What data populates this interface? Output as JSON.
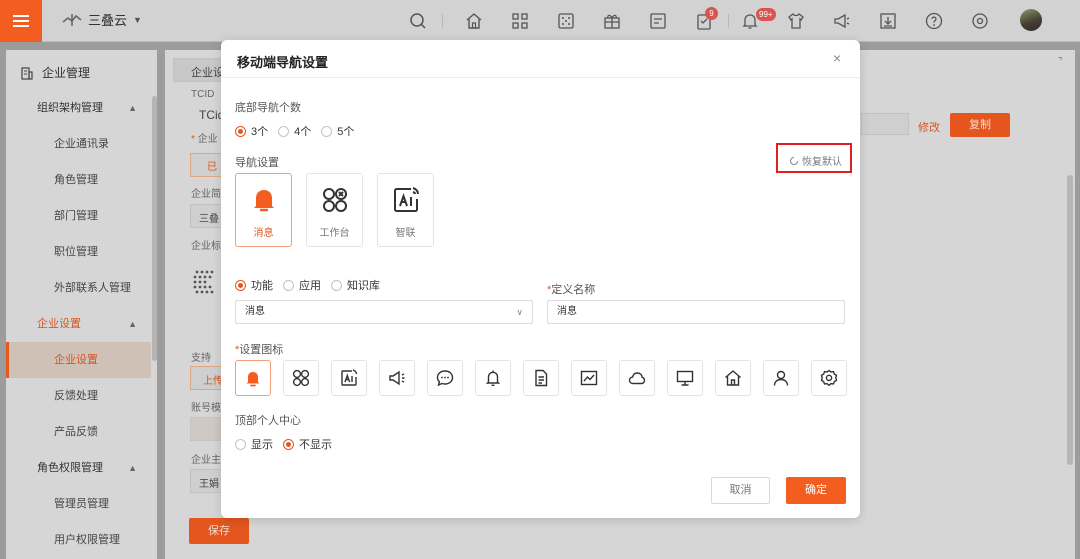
{
  "topbar": {
    "brand_name": "三叠云",
    "icons": [
      "search-icon",
      "home-icon",
      "apps-icon",
      "dice-icon",
      "gift-icon",
      "form-icon",
      "task-icon",
      "bell-icon",
      "shirt-icon",
      "megaphone-icon",
      "download-icon",
      "help-icon",
      "settings-icon"
    ],
    "task_badge": "9",
    "bell_badge": "99+",
    "accent_color": "#f35d1f"
  },
  "sidebar": {
    "title": "企业管理",
    "items": [
      {
        "label": "组织架构管理",
        "kind": "group"
      },
      {
        "label": "企业通讯录",
        "kind": "sub"
      },
      {
        "label": "角色管理",
        "kind": "sub"
      },
      {
        "label": "部门管理",
        "kind": "sub"
      },
      {
        "label": "职位管理",
        "kind": "sub"
      },
      {
        "label": "外部联系人管理",
        "kind": "sub"
      },
      {
        "label": "企业设置",
        "kind": "group-active"
      },
      {
        "label": "企业设置",
        "kind": "active"
      },
      {
        "label": "反馈处理",
        "kind": "sub"
      },
      {
        "label": "产品反馈",
        "kind": "sub"
      },
      {
        "label": "角色权限管理",
        "kind": "group"
      },
      {
        "label": "管理员管理",
        "kind": "sub"
      },
      {
        "label": "用户权限管理",
        "kind": "sub"
      }
    ]
  },
  "background": {
    "tcid_label": "TCID",
    "tcid_value": "TCid",
    "modify_label": "修改",
    "copy_label": "复制",
    "save_label": "保存",
    "fragments": [
      "企业设",
      "企业",
      "已",
      "企业简",
      "三叠",
      "企业标",
      "支持",
      "上传",
      "账号模",
      "企业主",
      "王娟"
    ]
  },
  "modal": {
    "title": "移动端导航设置",
    "close": "×",
    "count_label": "底部导航个数",
    "count_options": [
      "3个",
      "4个",
      "5个"
    ],
    "count_selected": "3个",
    "nav_settings_label": "导航设置",
    "restore_label": "恢复默认",
    "nav_cards": [
      {
        "label": "消息",
        "icon": "bell-icon",
        "selected": true
      },
      {
        "label": "工作台",
        "icon": "workbench-icon",
        "selected": false
      },
      {
        "label": "智联",
        "icon": "ai-icon",
        "selected": false
      }
    ],
    "type_options": [
      "功能",
      "应用",
      "知识库"
    ],
    "type_selected": "功能",
    "function_select_value": "消息",
    "custom_name_label": "定义名称",
    "custom_name_value": "消息",
    "icon_label": "设置图标",
    "icon_choices": [
      "bell-icon",
      "workbench-icon",
      "ai-icon",
      "megaphone-icon",
      "chat-icon",
      "bell-outline-icon",
      "document-icon",
      "chart-icon",
      "cloud-icon",
      "monitor-icon",
      "home-icon",
      "user-icon",
      "gear-icon"
    ],
    "icon_selected": "bell-icon",
    "top_center_label": "顶部个人中心",
    "top_center_options": [
      "显示",
      "不显示"
    ],
    "top_center_selected": "不显示",
    "cancel_label": "取消",
    "ok_label": "确定"
  }
}
